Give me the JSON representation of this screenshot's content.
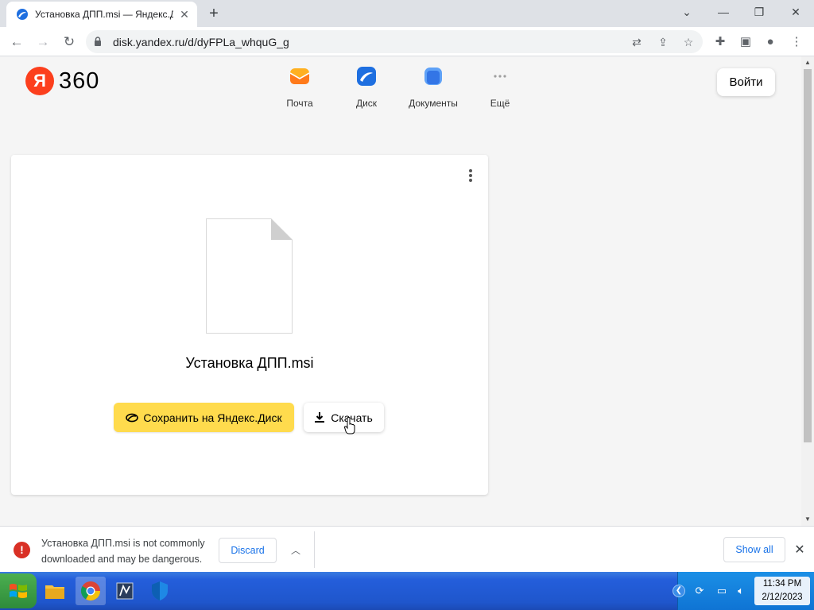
{
  "browser": {
    "tab_title": "Установка ДПП.msi — Яндекс.Д",
    "new_tab_symbol": "+",
    "url": "disk.yandex.ru/d/dyFPLa_whquG_g"
  },
  "header": {
    "logo_ya": "Я",
    "logo_360": "360",
    "services": [
      {
        "label": "Почта",
        "icon": "mail-icon",
        "color": "#ffb020"
      },
      {
        "label": "Диск",
        "icon": "disk-icon",
        "color": "#1e6fe0"
      },
      {
        "label": "Документы",
        "icon": "documents-icon",
        "color": "#3e8df0"
      },
      {
        "label": "Ещё",
        "icon": "more-icon",
        "color": "#9e9e9e"
      }
    ],
    "login_label": "Войти"
  },
  "file_card": {
    "file_name": "Установка ДПП.msi",
    "save_button": "Сохранить на Яндекс.Диск",
    "download_button": "Скачать"
  },
  "download_bar": {
    "message": "Установка ДПП.msi is not commonly downloaded and may be dangerous.",
    "discard_label": "Discard",
    "show_all_label": "Show all"
  },
  "taskbar": {
    "time": "11:34 PM",
    "date": "2/12/2023"
  },
  "colors": {
    "accent_yellow": "#ffdb4d",
    "yandex_red": "#fc3f1d",
    "link_blue": "#1a73e8",
    "warning_red": "#d93025"
  }
}
